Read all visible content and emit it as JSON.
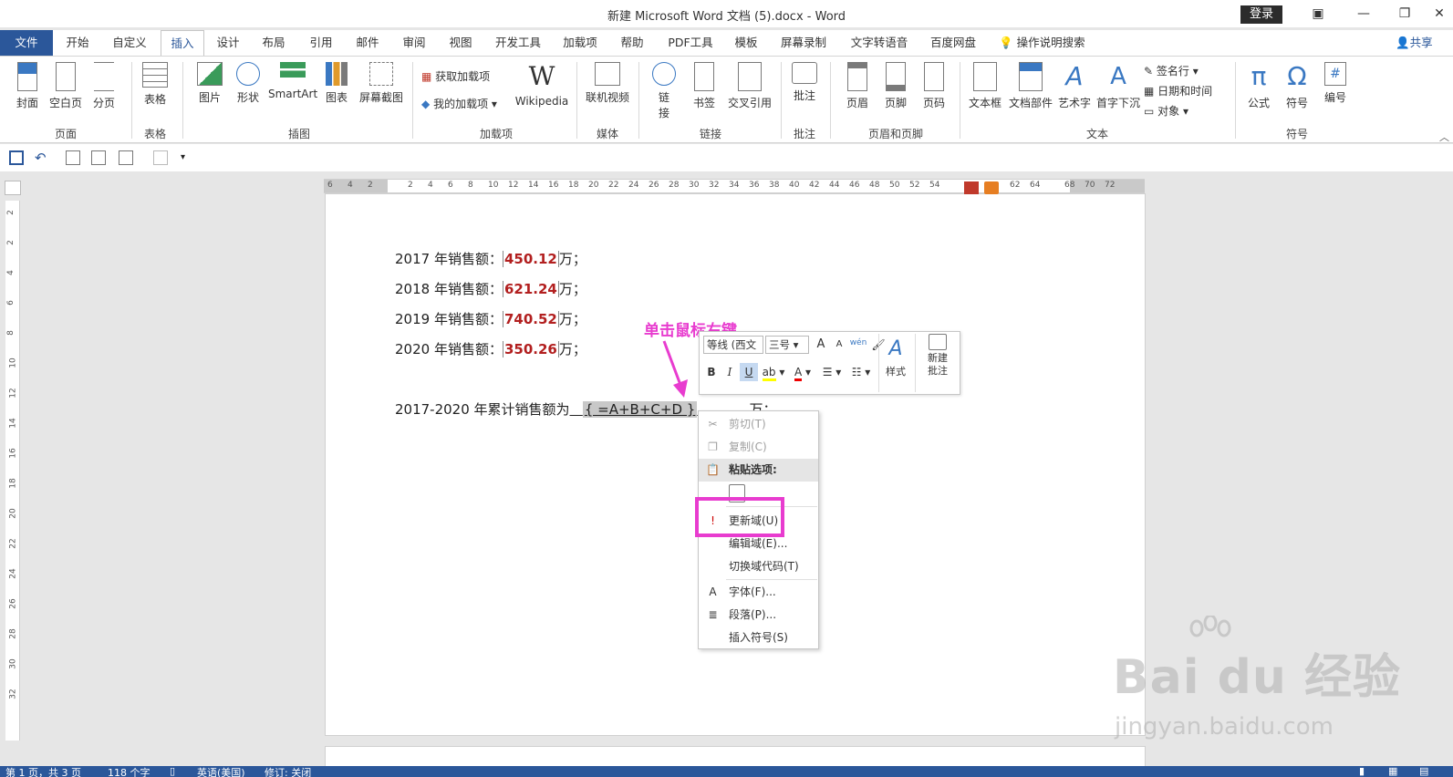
{
  "app": {
    "title": "新建 Microsoft Word 文档 (5).docx  -  Word",
    "login": "登录"
  },
  "tabs": [
    "文件",
    "开始",
    "自定义",
    "插入",
    "设计",
    "布局",
    "引用",
    "邮件",
    "审阅",
    "视图",
    "开发工具",
    "加载项",
    "帮助",
    "PDF工具",
    "模板",
    "屏幕录制",
    "文字转语音",
    "百度网盘"
  ],
  "tellme": "操作说明搜索",
  "share": "共享",
  "ribbon": {
    "page": {
      "cover": "封面",
      "blank": "空白页",
      "break": "分页",
      "label": "页面"
    },
    "table": {
      "table": "表格",
      "label": "表格"
    },
    "illus": {
      "picture": "图片",
      "shape": "形状",
      "smartart": "SmartArt",
      "chart": "图表",
      "screenshot": "屏幕截图",
      "label": "插图"
    },
    "addins": {
      "get": "获取加载项",
      "my": "我的加载项",
      "wiki_logo": "W",
      "wiki": "Wikipedia",
      "label": "加载项"
    },
    "media": {
      "video": "联机视频",
      "label": "媒体"
    },
    "links": {
      "link1": "链",
      "link2": "接",
      "bookmark": "书签",
      "crossref": "交叉引用",
      "label": "链接"
    },
    "comments": {
      "comment": "批注",
      "label": "批注"
    },
    "hf": {
      "header": "页眉",
      "footer": "页脚",
      "pagenum": "页码",
      "label": "页眉和页脚"
    },
    "text": {
      "textbox": "文本框",
      "parts": "文档部件",
      "wordart": "艺术字",
      "dropcap": "首字下沉",
      "sign": "签名行",
      "datetime": "日期和时间",
      "object": "对象",
      "label": "文本"
    },
    "symbols": {
      "equation": "公式",
      "symbol": "符号",
      "number": "编号",
      "label": "符号"
    }
  },
  "ruler_h": [
    "6",
    "4",
    "2",
    "2",
    "4",
    "6",
    "8",
    "10",
    "12",
    "14",
    "16",
    "18",
    "20",
    "22",
    "24",
    "26",
    "28",
    "30",
    "32",
    "34",
    "36",
    "38",
    "40",
    "42",
    "44",
    "46",
    "48",
    "50",
    "52",
    "54",
    "62",
    "64",
    "68",
    "70",
    "72"
  ],
  "ruler_v": [
    "2",
    "2",
    "4",
    "6",
    "8",
    "10",
    "12",
    "14",
    "16",
    "18",
    "20",
    "22",
    "24",
    "26",
    "28",
    "30",
    "32"
  ],
  "document": {
    "lines": [
      {
        "prefix": "2017 年销售额：",
        "value": "450.12",
        "suffix": "万；"
      },
      {
        "prefix": "2018 年销售额：",
        "value": "621.24",
        "suffix": "万；"
      },
      {
        "prefix": "2019 年销售额：",
        "value": "740.52",
        "suffix": "万；"
      },
      {
        "prefix": "2020 年销售额：",
        "value": "350.26",
        "suffix": "万；"
      }
    ],
    "total_prefix": "2017-2020 年累计销售额为",
    "field_code": "{ =A+B+C+D }",
    "total_suffix": "万；"
  },
  "annotation": "单击鼠标右键",
  "minitoolbar": {
    "font": "等线 (西文",
    "size": "三号",
    "grow": "A",
    "shrink": "A",
    "phonetic": "wén",
    "bold": "B",
    "italic": "I",
    "underline": "U",
    "styles": "样式",
    "newcomment1": "新建",
    "newcomment2": "批注"
  },
  "contextmenu": {
    "cut": "剪切(T)",
    "copy": "复制(C)",
    "paste_options": "粘贴选项:",
    "update_field": "更新域(U)",
    "edit_field": "编辑域(E)...",
    "toggle_codes": "切换域代码(T)",
    "font": "字体(F)...",
    "paragraph": "段落(P)...",
    "insert_symbol": "插入符号(S)"
  },
  "status": {
    "page": "第 1 页，共 3 页",
    "words": "118 个字",
    "lang": "英语(美国)",
    "track": "修订: 关闭"
  },
  "watermark": {
    "big": "Bai du 经验",
    "small": "jingyan.baidu.com"
  },
  "colors": {
    "accent": "#2b579a",
    "annotation": "#e83ccf",
    "value": "#b21f1f"
  }
}
